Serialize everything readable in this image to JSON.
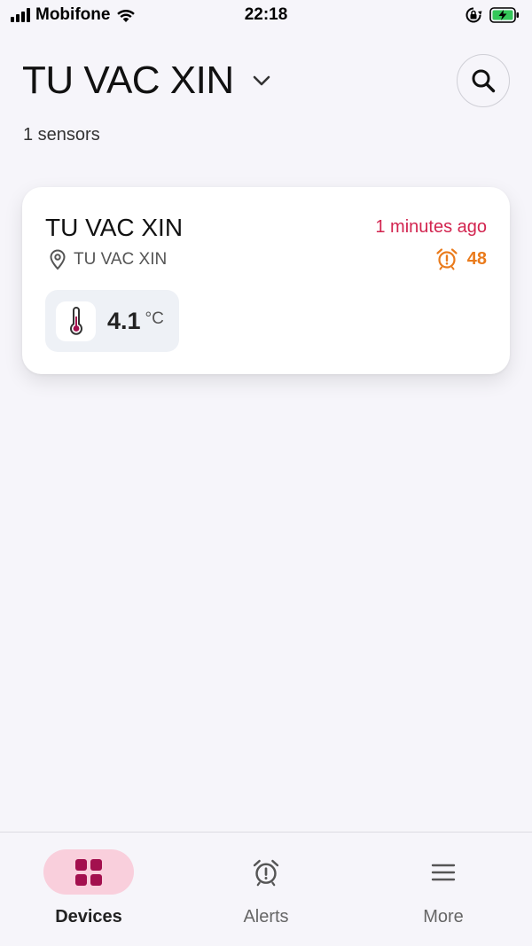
{
  "status_bar": {
    "carrier": "Mobifone",
    "time": "22:18"
  },
  "header": {
    "title": "TU VAC XIN",
    "sensor_count": "1 sensors"
  },
  "devices": [
    {
      "name": "TU VAC XIN",
      "location": "TU VAC XIN",
      "last_update": "1 minutes ago",
      "alert_count": "48",
      "reading_value": "4.1",
      "reading_unit": "°C"
    }
  ],
  "tabs": [
    {
      "label": "Devices",
      "icon": "grid-icon",
      "active": true
    },
    {
      "label": "Alerts",
      "icon": "alarm-clock-icon",
      "active": false
    },
    {
      "label": "More",
      "icon": "menu-icon",
      "active": false
    }
  ],
  "colors": {
    "accent": "#a3104e",
    "accent_bg": "#f9cfdc",
    "time_red": "#d2244f",
    "alert_orange": "#ea7b1c",
    "battery_green": "#34c759"
  }
}
